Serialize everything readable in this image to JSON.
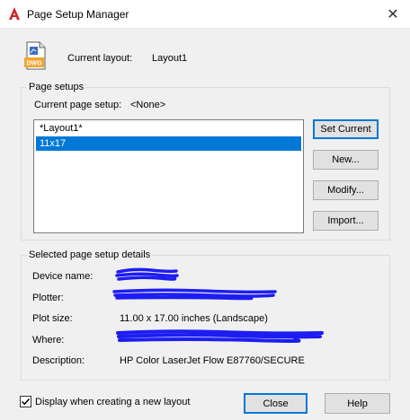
{
  "window": {
    "title": "Page Setup Manager",
    "app_icon": "autocad-a-icon",
    "close_glyph": "✕"
  },
  "current_layout": {
    "label": "Current layout:",
    "value": "Layout1",
    "icon": "dwg-file-icon",
    "icon_text": "DWG"
  },
  "page_setups": {
    "legend": "Page setups",
    "current_setup_label": "Current page setup:",
    "current_setup_value": "<None>",
    "items": [
      {
        "label": "*Layout1*",
        "selected": false
      },
      {
        "label": "11x17",
        "selected": true
      }
    ],
    "buttons": {
      "set_current": "Set Current",
      "new": "New...",
      "modify": "Modify...",
      "import": "Import..."
    }
  },
  "details": {
    "legend": "Selected page setup details",
    "device_name_label": "Device name:",
    "plotter_label": "Plotter:",
    "plot_size_label": "Plot size:",
    "plot_size_value": "11.00 x 17.00 inches (Landscape)",
    "where_label": "Where:",
    "description_label": "Description:",
    "description_value": "HP Color LaserJet Flow E87760/SECURE"
  },
  "footer": {
    "checkbox_label": "Display when creating a new layout",
    "checkbox_checked": true,
    "close_label": "Close",
    "help_label": "Help"
  },
  "colors": {
    "selection": "#0078d7",
    "redaction": "#1d1df2",
    "autocad_red": "#d2232a",
    "dwg_blue": "#3b6fc2",
    "dwg_orange": "#f0a530"
  }
}
